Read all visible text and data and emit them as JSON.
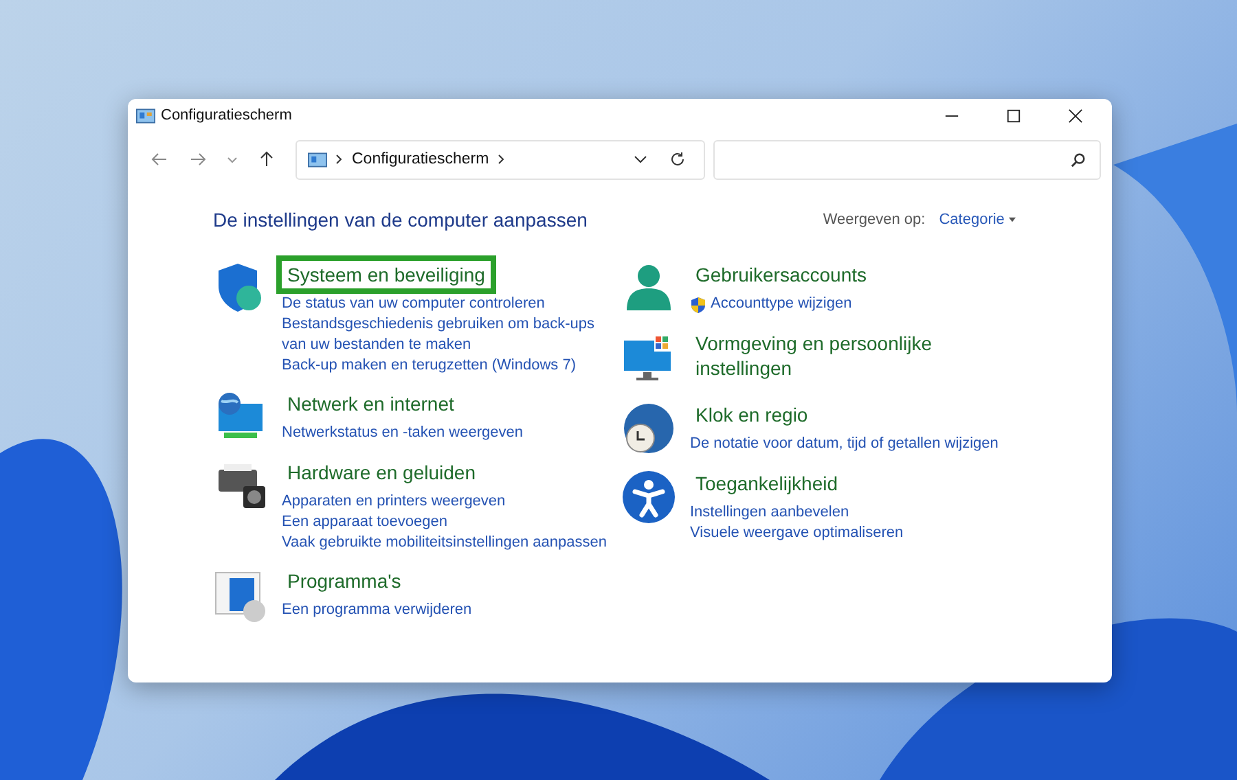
{
  "window": {
    "title": "Configuratiescherm"
  },
  "address": {
    "path": "Configuratiescherm"
  },
  "heading": "De instellingen van de computer aanpassen",
  "view_by": {
    "label": "Weergeven op:",
    "value": "Categorie"
  },
  "columns": [
    [
      {
        "kind": "security",
        "title": "Systeem en beveiliging",
        "highlighted": true,
        "links": [
          {
            "text": "De status van uw computer controleren",
            "shield": false
          },
          {
            "text": "Bestandsgeschiedenis gebruiken om back-ups van uw bestanden te maken",
            "shield": false
          },
          {
            "text": "Back-up maken en terugzetten (Windows 7)",
            "shield": false
          }
        ]
      },
      {
        "kind": "network",
        "title": "Netwerk en internet",
        "highlighted": false,
        "links": [
          {
            "text": "Netwerkstatus en -taken weergeven",
            "shield": false
          }
        ]
      },
      {
        "kind": "hardware",
        "title": "Hardware en geluiden",
        "highlighted": false,
        "links": [
          {
            "text": "Apparaten en printers weergeven",
            "shield": false
          },
          {
            "text": "Een apparaat toevoegen",
            "shield": false
          },
          {
            "text": "Vaak gebruikte mobiliteitsinstellingen aanpassen",
            "shield": false
          }
        ]
      },
      {
        "kind": "programs",
        "title": "Programma's",
        "highlighted": false,
        "links": [
          {
            "text": "Een programma verwijderen",
            "shield": false
          }
        ]
      }
    ],
    [
      {
        "kind": "user",
        "title": "Gebruikersaccounts",
        "highlighted": false,
        "links": [
          {
            "text": "Accounttype wijzigen",
            "shield": true
          }
        ]
      },
      {
        "kind": "appearance",
        "title": "Vormgeving en persoonlijke instellingen",
        "highlighted": false
      },
      {
        "kind": "clock",
        "title": "Klok en regio",
        "highlighted": false,
        "links": [
          {
            "text": "De notatie voor datum, tijd of getallen wijzigen",
            "shield": false
          }
        ]
      },
      {
        "kind": "access",
        "title": "Toegankelijkheid",
        "highlighted": false,
        "links": [
          {
            "text": "Instellingen aanbevelen",
            "shield": false
          },
          {
            "text": "Visuele weergave optimaliseren",
            "shield": false
          }
        ]
      }
    ]
  ]
}
